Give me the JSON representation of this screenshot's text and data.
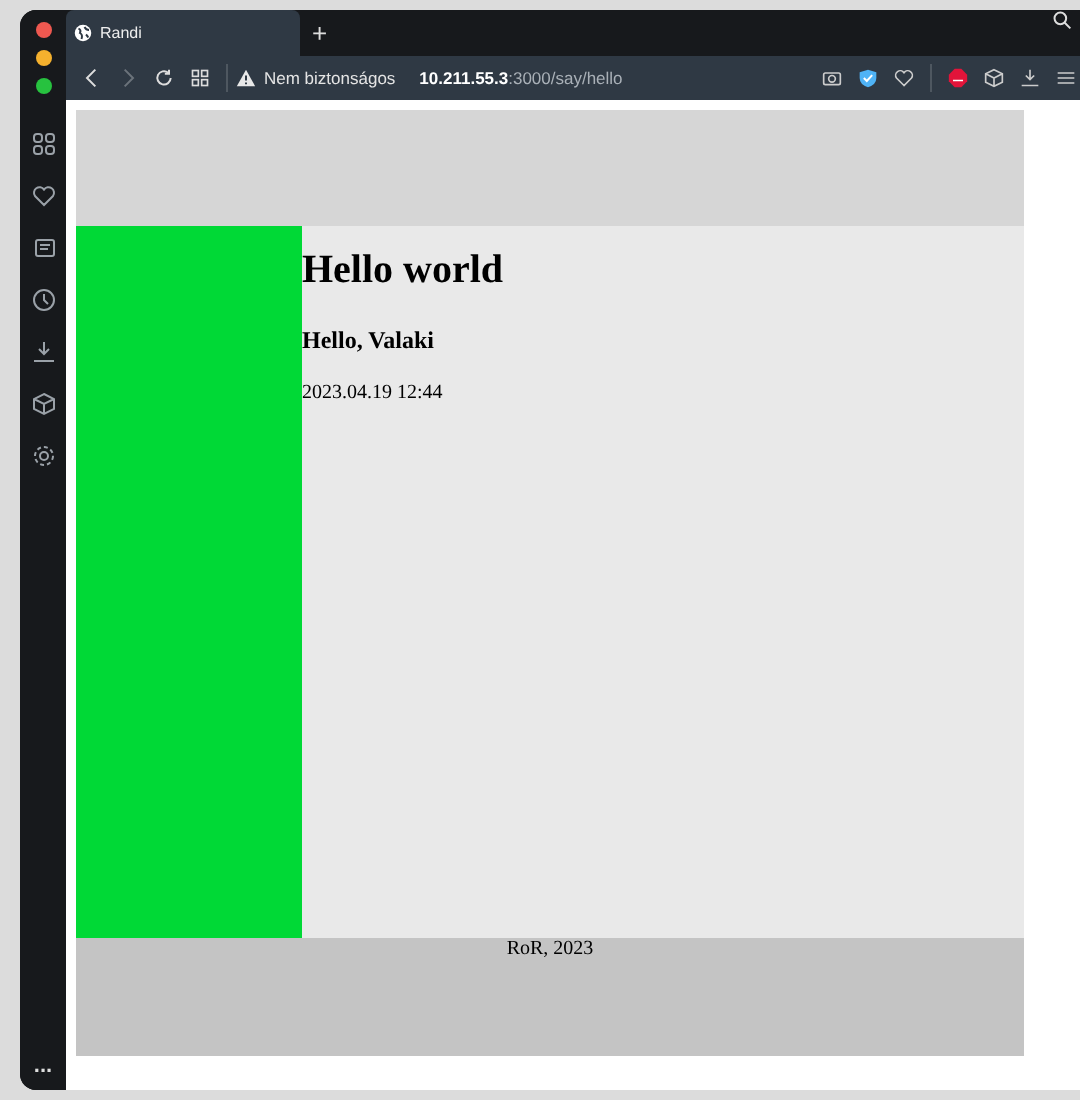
{
  "tab": {
    "title": "Randi",
    "selected": true
  },
  "new_tab": "+",
  "address_bar": {
    "security": "Nem biztonságos",
    "url": "**10.211.55.3**:3000/say/hello"
  },
  "sidebar": {
    "more": "..."
  },
  "page": {
    "heading": "Hello world",
    "greeting": "Hello, Valaki",
    "timestamp": "2023.04.19 12:44",
    "footer": "RoR, 2023"
  }
}
